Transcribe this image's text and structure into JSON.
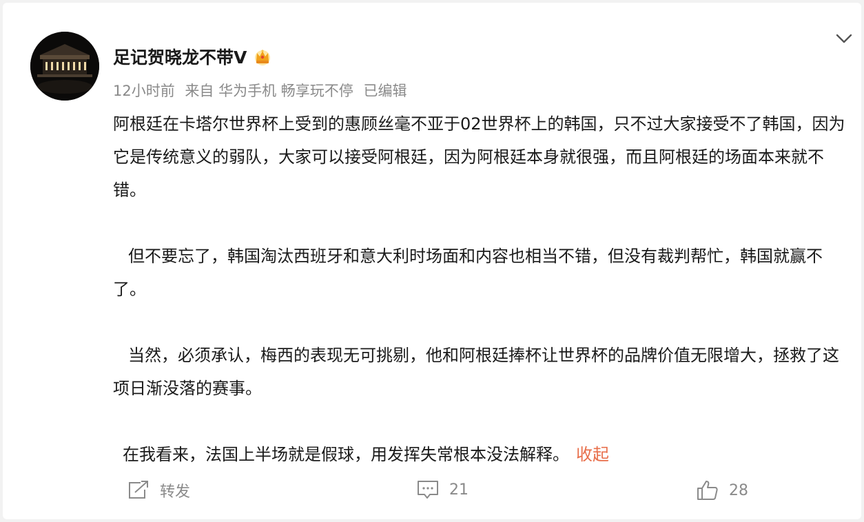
{
  "post": {
    "author": {
      "name": "足记贺晓龙不带V",
      "badge_icon": "vip-crown-icon"
    },
    "meta": {
      "time": "12小时前",
      "source": "来自 华为手机 畅享玩不停",
      "edited": "已编辑"
    },
    "paragraphs": [
      "阿根廷在卡塔尔世界杯上受到的惠顾丝毫不亚于02世界杯上的韩国，只不过大家接受不了韩国，因为它是传统意义的弱队，大家可以接受阿根廷，因为阿根廷本身就很强，而且阿根廷的场面本来就不错。",
      "但不要忘了，韩国淘汰西班牙和意大利时场面和内容也相当不错，但没有裁判帮忙，韩国就赢不了。",
      "当然，必须承认，梅西的表现无可挑剔，他和阿根廷捧杯让世界杯的品牌价值无限增大，拯救了这项日渐没落的赛事。",
      "在我看来，法国上半场就是假球，用发挥失常根本没法解释。"
    ],
    "collapse_label": "收起",
    "actions": {
      "repost_label": "转发",
      "comment_count": "21",
      "like_count": "28"
    },
    "colors": {
      "accent": "#e86f4b",
      "secondary_text": "#8a8a8a",
      "primary_text": "#1a1a1a"
    }
  }
}
